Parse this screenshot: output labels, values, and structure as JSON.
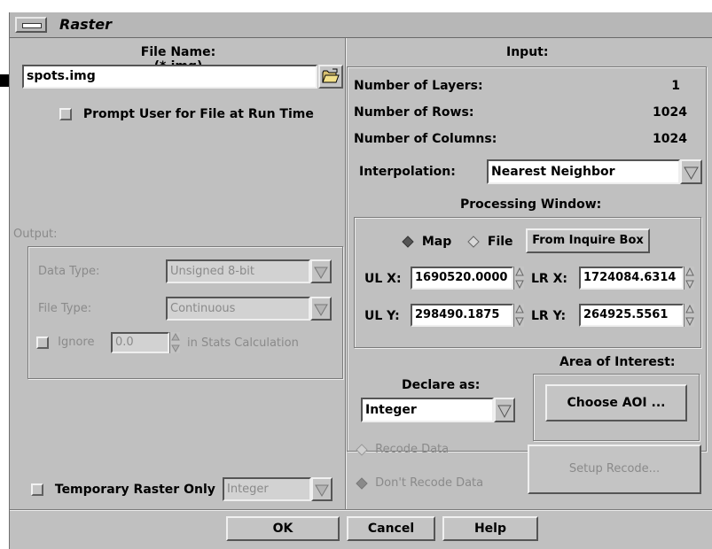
{
  "window": {
    "title": "Raster"
  },
  "left": {
    "file_name_label": "File Name: (*.img)",
    "file_name_value": "spots.img",
    "prompt_user_label": "Prompt User for File at Run Time",
    "output_label": "Output:",
    "data_type_label": "Data Type:",
    "data_type_value": "Unsigned 8-bit",
    "file_type_label": "File Type:",
    "file_type_value": "Continuous",
    "ignore_label": "Ignore",
    "ignore_value": "0.0",
    "stats_label": "in Stats Calculation",
    "temp_raster_label": "Temporary Raster Only",
    "temp_raster_value": "Integer"
  },
  "input": {
    "title": "Input:",
    "layers_label": "Number of Layers:",
    "layers_value": "1",
    "rows_label": "Number of Rows:",
    "rows_value": "1024",
    "cols_label": "Number of Columns:",
    "cols_value": "1024",
    "interpolation_label": "Interpolation:",
    "interpolation_value": "Nearest Neighbor",
    "processing_window_label": "Processing Window:",
    "map_label": "Map",
    "file_label": "File",
    "inquire_box_button": "From Inquire Box",
    "ulx_label": "UL X:",
    "ulx_value": "1690520.0000",
    "lrx_label": "LR X:",
    "lrx_value": "1724084.6314",
    "uly_label": "UL Y:",
    "uly_value": "298490.1875",
    "lry_label": "LR Y:",
    "lry_value": "264925.5561",
    "aoi_label": "Area of Interest:",
    "declare_label": "Declare as:",
    "declare_value": "Integer",
    "choose_aoi_button": "Choose AOI ...",
    "recode_data_label": "Recode Data",
    "dont_recode_label": "Don't Recode Data",
    "setup_recode_button": "Setup Recode..."
  },
  "buttons": {
    "ok": "OK",
    "cancel": "Cancel",
    "help": "Help"
  }
}
